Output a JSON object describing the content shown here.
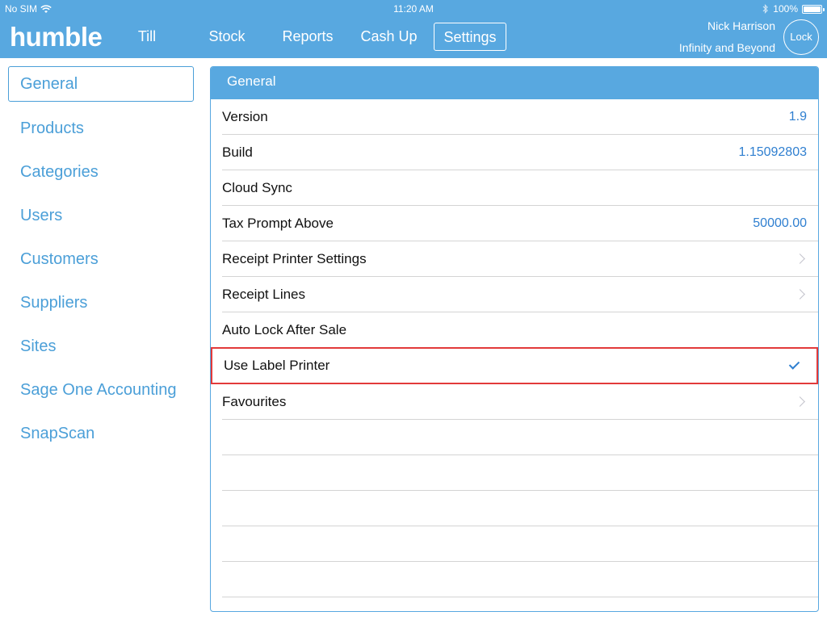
{
  "status_bar": {
    "carrier": "No SIM",
    "time": "11:20 AM",
    "battery": "100%",
    "battery_level": 1.0
  },
  "header": {
    "logo": "humble",
    "nav": [
      {
        "label": "Till"
      },
      {
        "label": "Stock"
      },
      {
        "label": "Reports"
      },
      {
        "label": "Cash Up"
      },
      {
        "label": "Settings",
        "active": true
      }
    ],
    "user_name": "Nick Harrison",
    "org_name": "Infinity and Beyond",
    "lock_label": "Lock"
  },
  "sidebar": {
    "items": [
      {
        "label": "General",
        "active": true
      },
      {
        "label": "Products"
      },
      {
        "label": "Categories"
      },
      {
        "label": "Users"
      },
      {
        "label": "Customers"
      },
      {
        "label": "Suppliers"
      },
      {
        "label": "Sites"
      },
      {
        "label": "Sage One Accounting"
      },
      {
        "label": "SnapScan"
      }
    ]
  },
  "panel": {
    "title": "General",
    "rows": [
      {
        "label": "Version",
        "value": "1.9"
      },
      {
        "label": "Build",
        "value": "1.15092803"
      },
      {
        "label": "Cloud Sync",
        "value": ""
      },
      {
        "label": "Tax Prompt Above",
        "value": "50000.00"
      },
      {
        "label": "Receipt Printer Settings",
        "accessory": "chevron"
      },
      {
        "label": "Receipt Lines",
        "accessory": "chevron"
      },
      {
        "label": "Auto Lock After Sale",
        "value": ""
      },
      {
        "label": "Use Label Printer",
        "accessory": "check",
        "highlighted": true
      },
      {
        "label": "Favourites",
        "accessory": "chevron"
      }
    ]
  },
  "colors": {
    "brand_blue": "#58a8e0",
    "link_blue": "#4b9fd8",
    "value_blue": "#2f7fd0",
    "highlight_red": "#e23a3a"
  }
}
